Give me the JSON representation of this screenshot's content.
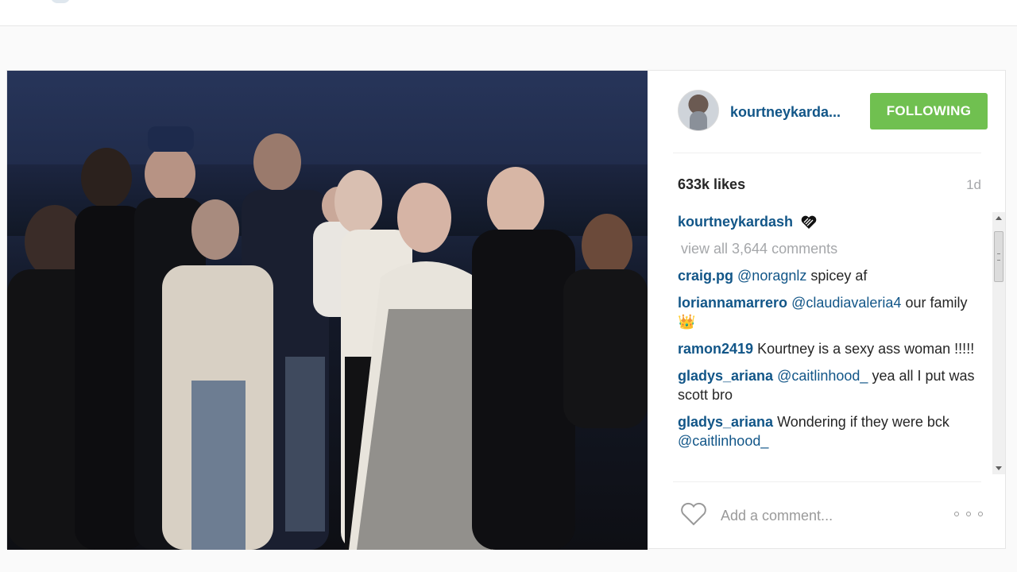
{
  "post": {
    "author": "kourtneykarda...",
    "follow_label": "FOLLOWING",
    "likes": "633k likes",
    "age": "1d",
    "caption": {
      "user": "kourtneykardash"
    },
    "view_all": "view all 3,644 comments",
    "comments": [
      {
        "user": "craig.pg",
        "mention": "@noragnlz",
        "text": " spicey af"
      },
      {
        "user": "loriannamarrero",
        "mention": "@claudiavaleria4",
        "text": " our family 👑"
      },
      {
        "user": "ramon2419",
        "mention": "",
        "text": "Kourtney is a sexy ass woman !!!!!"
      },
      {
        "user": "gladys_ariana",
        "mention": "@caitlinhood_",
        "text": " yea all I put was scott bro"
      },
      {
        "user": "gladys_ariana",
        "mention": "",
        "text": "Wondering if they were bck ",
        "mention_after": "@caitlinhood_"
      }
    ],
    "comment_placeholder": "Add a comment..."
  },
  "colors": {
    "link": "#125688",
    "follow_button": "#70c050",
    "muted": "#a5a7aa"
  },
  "icons": {
    "like": "heart-outline-icon",
    "more": "ellipsis-icon",
    "caption": "black-heart-icon"
  }
}
